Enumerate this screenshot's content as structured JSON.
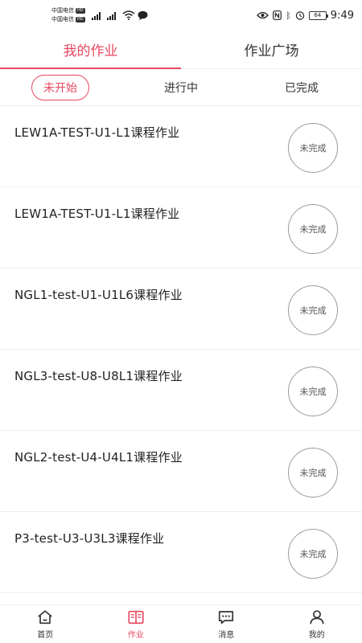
{
  "status_bar": {
    "carrier1": "中国电信",
    "carrier2": "中国电信",
    "hd_badge": "HD",
    "signal1": "4G",
    "battery": "64",
    "time": "9:49"
  },
  "top_tabs": [
    {
      "label": "我的作业",
      "active": true
    },
    {
      "label": "作业广场",
      "active": false
    }
  ],
  "sub_tabs": [
    {
      "label": "未开始",
      "active": true
    },
    {
      "label": "进行中",
      "active": false
    },
    {
      "label": "已完成",
      "active": false
    }
  ],
  "assignments": [
    {
      "title": "LEW1A-TEST-U1-L1课程作业",
      "status": "未完成"
    },
    {
      "title": "LEW1A-TEST-U1-L1课程作业",
      "status": "未完成"
    },
    {
      "title": "NGL1-test-U1-U1L6课程作业",
      "status": "未完成"
    },
    {
      "title": "NGL3-test-U8-U8L1课程作业",
      "status": "未完成"
    },
    {
      "title": "NGL2-test-U4-U4L1课程作业",
      "status": "未完成"
    },
    {
      "title": "P3-test-U3-U3L3课程作业",
      "status": "未完成"
    }
  ],
  "bottom_nav": [
    {
      "label": "首页",
      "icon": "home-icon",
      "active": false
    },
    {
      "label": "作业",
      "icon": "book-icon",
      "active": true
    },
    {
      "label": "消息",
      "icon": "message-icon",
      "active": false
    },
    {
      "label": "我的",
      "icon": "user-icon",
      "active": false
    }
  ],
  "colors": {
    "accent": "#e8475f",
    "text": "#222222",
    "divider": "#eeeeee"
  }
}
